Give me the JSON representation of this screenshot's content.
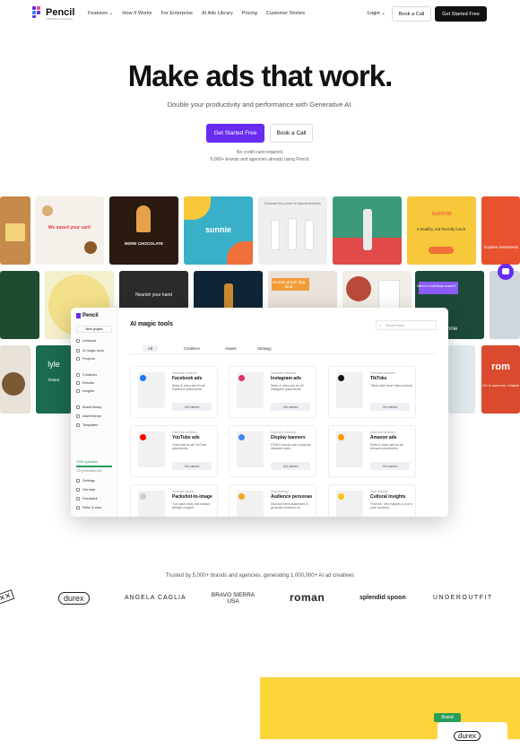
{
  "nav": {
    "logo_text": "Pencil",
    "logo_sub": "A Brandtech Company",
    "links": [
      "Features",
      "How It Works",
      "For Enterprise",
      "AI Ads Library",
      "Pricing",
      "Customer Stories"
    ],
    "login": "Login",
    "book_call": "Book a Call",
    "get_started": "Get Started Free"
  },
  "hero": {
    "title": "Make ads that work.",
    "subtitle": "Double your productivity and performance with Generative AI.",
    "cta_primary": "Get Started Free",
    "cta_secondary": "Book a Call",
    "note1": "No credit card required.",
    "note2": "5,000+ brands and agencies already using Pencil.",
    "accent": "#6a2bf0"
  },
  "gallery": {
    "captions": [
      "We saved your cart!",
      "MORE CHOCOLATE",
      "sunnie",
      "Embrace the power of natural elements",
      "sunnie",
      "A healthy, kid-friendly lunch.",
      "Nourish your hand",
      "Human grade dog food",
      "Need a nutritious snack?",
      "sunnie",
      "lyle",
      "Rated",
      "rom",
      "Explore treatments",
      "ED is common, treatab"
    ]
  },
  "app": {
    "logo": "Pencil",
    "new_project": "New project",
    "sidebar": [
      "Uniboost",
      "AI magic tools",
      "Projects",
      "Creatives",
      "Results",
      "Insights",
      "Brand library",
      "Asset library",
      "Templates"
    ],
    "quota": "100% optimised",
    "quota_sub": "100 generations left",
    "sidebar_bottom": [
      "Settings",
      "Get help",
      "Feedback",
      "Refer & earn"
    ],
    "title": "AI magic tools",
    "search_placeholder": "Search tools",
    "tabs": [
      "All",
      "Creatives",
      "Assets",
      "Strategy"
    ],
    "cards": [
      {
        "kind": "Generate creatives",
        "title": "Facebook ads",
        "desc": "Static & video ads for all Facebook placements.",
        "cta": "Get started",
        "color": "#1877f2"
      },
      {
        "kind": "Generate creatives",
        "title": "Instagram ads",
        "desc": "Static & video ads for all Instagram placements.",
        "cta": "Get started",
        "color": "#e1306c"
      },
      {
        "kind": "Generate creatives",
        "title": "TikToks",
        "desc": "Tiktok-style short video content.",
        "cta": "Get started",
        "color": "#111111"
      },
      {
        "kind": "Generate creatives",
        "title": "YouTube ads",
        "desc": "Video ads for all YouTube placements.",
        "cta": "Get started",
        "color": "#ff0000"
      },
      {
        "kind": "Generate creatives",
        "title": "Display banners",
        "desc": "HTML5 banner ads in popular standard sizes.",
        "cta": "Get started",
        "color": "#4285f4"
      },
      {
        "kind": "Generate creatives",
        "title": "Amazon ads",
        "desc": "Static & video ads for all Amazon placements.",
        "cta": "Get started",
        "color": "#ff9900"
      },
      {
        "kind": "Generate assets",
        "title": "Packshot-to-image",
        "desc": "Turn pack shots into brilliant lifestyle images!",
        "cta": "",
        "color": "#cccccc"
      },
      {
        "kind": "Chat strategy",
        "title": "Audience personas",
        "desc": "Discover fresh audiences to generate creatives for.",
        "cta": "",
        "color": "#f2a81e"
      },
      {
        "kind": "Chat strategy",
        "title": "Cultural insights",
        "desc": "Find rich, new insights to use in your creatives.",
        "cta": "",
        "color": "#f5c518"
      }
    ]
  },
  "trusted": {
    "text": "Trusted by 5,000+ brands and agencies, generating 1,000,000+ AI ad creatives",
    "brands": [
      "durex",
      "ANGELA CAGLIA",
      "BRAVO SIERRA USA",
      "roman",
      "splendid spoon",
      "UNDEROUTFIT"
    ]
  },
  "bottom": {
    "badge": "Brand",
    "brand": "durex"
  }
}
